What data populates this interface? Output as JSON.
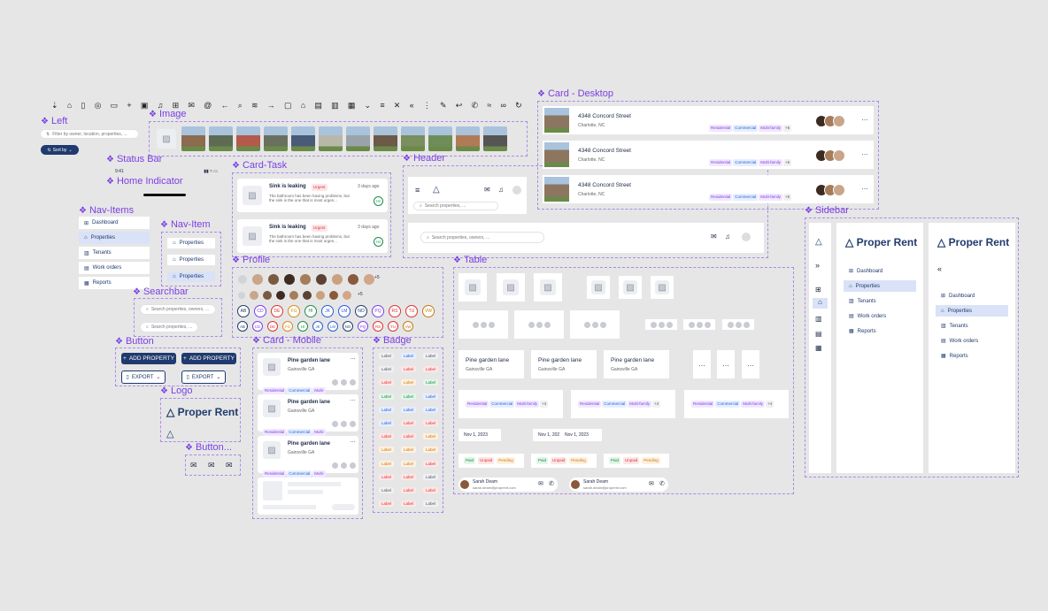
{
  "sections": {
    "left": "Left",
    "image": "Image",
    "status_bar": "Status Bar",
    "home_indicator": "Home Indicator",
    "nav_items": "Nav-Items",
    "nav_item": "Nav-Item",
    "searchbar": "Searchbar",
    "button": "Button",
    "logo": "Logo",
    "button_icon": "Button...",
    "card_task": "Card-Task",
    "profile": "Profile",
    "card_mobile": "Card - Mobile",
    "badge": "Badge",
    "header": "Header",
    "table": "Table",
    "card_desktop": "Card - Desktop",
    "sidebar": "Sidebar"
  },
  "left": {
    "filter_placeholder": "Filter by owner, location, properties, ...",
    "sort_label": "Sort by"
  },
  "status_bar": {
    "time": "9:41"
  },
  "nav_items": [
    "Dashboard",
    "Properties",
    "Tenants",
    "Work orders",
    "Reports"
  ],
  "nav_item": [
    "Properties",
    "Properties",
    "Properties"
  ],
  "searchbar": {
    "placeholder": "Search properties, owners, ...",
    "placeholder_short": "Search properties, ..."
  },
  "buttons": {
    "add_property": "ADD PROPERTY",
    "export": "EXPORT"
  },
  "logo": {
    "name": "Proper Rent"
  },
  "card_task": {
    "title": "Sink is leaking",
    "badge": "Urgent",
    "time": "3 days ago",
    "body": "The bathroom has been having problems, but the sink is the one that is most urgen...",
    "initials": "HI"
  },
  "profile": {
    "more": "+5",
    "initials_row1": [
      "AB",
      "CD",
      "DE",
      "FG",
      "HI",
      "JK",
      "LM",
      "NO",
      "PQ",
      "RS",
      "TU",
      "VW"
    ],
    "initials_row2": [
      "AB",
      "CD",
      "DE",
      "FG",
      "HI",
      "JK",
      "LM",
      "NO",
      "PQ",
      "RS",
      "TU",
      "VW"
    ]
  },
  "card_mobile": {
    "title": "Pine garden lane",
    "subtitle": "Gainsville GA",
    "tags": [
      "Residential",
      "Commercial",
      "Multi-"
    ]
  },
  "badge": {
    "label": "Label"
  },
  "header": {
    "search": "Search properties, ...",
    "search_wide": "Search properties, owners, ..."
  },
  "table": {
    "cell_title": "Pine garden lane",
    "cell_subtitle": "Gainsville GA",
    "tags": [
      "Residential",
      "Commercial",
      "Multi-family",
      "+4"
    ],
    "date": "Nov 1, 2023",
    "status": [
      "Paid",
      "Unpaid",
      "Pending"
    ],
    "person_name": "Sarah Deam",
    "person_email": "sarah.deam@proprent.com"
  },
  "card_desktop": {
    "address": "4348 Concord Street",
    "city": "Charlotte, NC",
    "tags": [
      "Residential",
      "Commercial",
      "Multi-family",
      "+5"
    ]
  },
  "sidebar": {
    "brand": "Proper Rent",
    "items": [
      "Dashboard",
      "Properties",
      "Tenants",
      "Work orders",
      "Reports"
    ]
  },
  "colors": {
    "accent": "#7b3fe4",
    "brand": "#1f3a6e",
    "active_nav": "#d9e2f7",
    "canvas": "#e6e6e6"
  }
}
